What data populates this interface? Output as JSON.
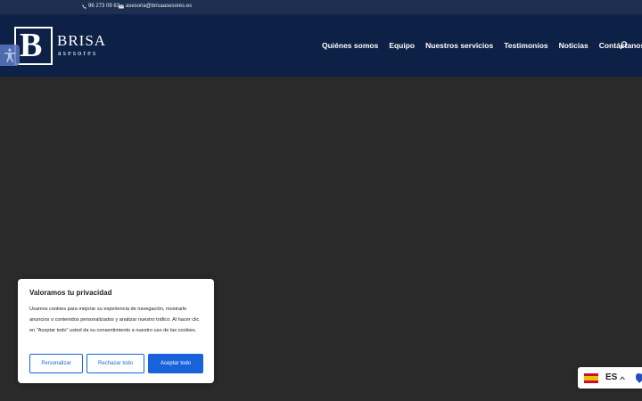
{
  "topbar": {
    "phone": "96 273 09 63",
    "email": "asesoria@brisaasesores.es"
  },
  "logo": {
    "letter": "B",
    "name": "BRISA",
    "subtitle": "asesores"
  },
  "nav": {
    "items": [
      "Quiénes somos",
      "Equipo",
      "Nuestros servicios",
      "Testimonios",
      "Noticias",
      "Contáctanos"
    ]
  },
  "cookie": {
    "title": "Valoramos tu privacidad",
    "text": "Usamos cookies para mejorar su experiencia de navegación, mostrarle anuncios o contenidos personalizados y analizar nuestro tráfico. Al hacer clic en \"Aceptar todo\" usted da su consentimiento a nuestro uso de las cookies.",
    "customize": "Personalizar",
    "reject": "Rechazar todo",
    "accept": "Aceptar todo"
  },
  "language": {
    "code": "ES"
  },
  "colors": {
    "topbar": "#1c2f50",
    "header": "#0d2146",
    "hero": "#2a2a2a",
    "accent": "#1863dc",
    "accessibility": "#5a79c3"
  },
  "icons": [
    "phone-icon",
    "mail-icon",
    "search-icon",
    "accessibility-icon",
    "spain-flag-icon",
    "caret-up-icon"
  ]
}
